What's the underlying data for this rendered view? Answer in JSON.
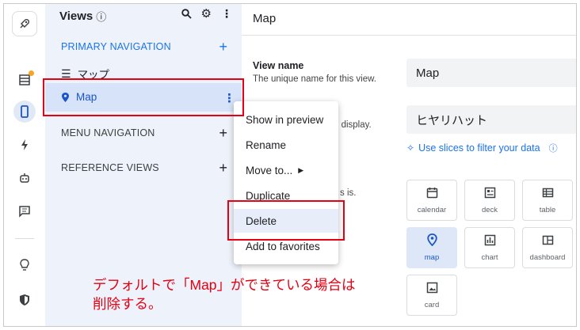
{
  "rail": {
    "icons": [
      "rocket-icon",
      "table-icon",
      "phone-icon",
      "bolt-icon",
      "robot-icon",
      "chat-icon",
      "lightbulb-icon",
      "shield-icon"
    ],
    "notification_color": "#f5a623"
  },
  "views_panel": {
    "title": "Views",
    "info_icon": "ⓘ",
    "sections": {
      "primary": "PRIMARY NAVIGATION",
      "menu": "MENU NAVIGATION",
      "reference": "REFERENCE VIEWS"
    },
    "items": {
      "mappu": "マップ",
      "map": "Map"
    }
  },
  "main": {
    "title": "Map",
    "view_name": {
      "label": "View name",
      "desc": "The unique name for this view.",
      "value": "Map"
    },
    "source": {
      "desc_visible": "o display.",
      "value": "ヒヤリハット"
    },
    "slices_link": "Use slices to filter your data",
    "type_desc_visible": "s is.",
    "view_types": [
      {
        "label": "calendar",
        "icon": "calendar-icon"
      },
      {
        "label": "deck",
        "icon": "deck-icon"
      },
      {
        "label": "table",
        "icon": "table-icon"
      },
      {
        "label": "map",
        "icon": "map-pin-icon",
        "selected": true
      },
      {
        "label": "chart",
        "icon": "chart-icon"
      },
      {
        "label": "dashboard",
        "icon": "dashboard-icon"
      },
      {
        "label": "card",
        "icon": "card-icon"
      }
    ]
  },
  "context_menu": {
    "items": [
      "Show in preview",
      "Rename",
      "Move to...",
      "Duplicate",
      "Delete",
      "Add to favorites"
    ]
  },
  "annotation": {
    "line1": "デフォルトで「Map」ができている場合は",
    "line2": "削除する。",
    "color": "#e60012"
  }
}
